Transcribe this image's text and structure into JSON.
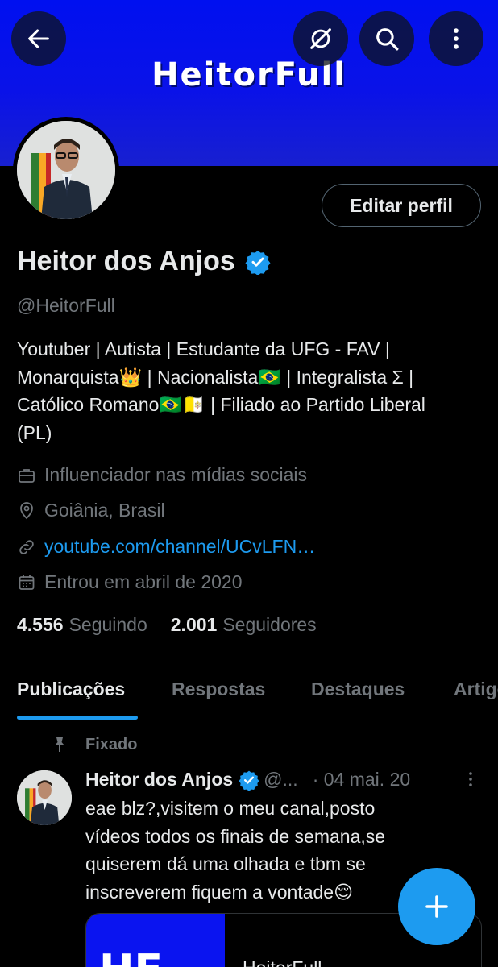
{
  "banner": {
    "text": "HeitorFull",
    "color": "#0010f0"
  },
  "header_actions": {
    "back_icon": "arrow-left-icon",
    "grok_icon": "grok-icon",
    "search_icon": "search-icon",
    "more_icon": "more-vertical-icon"
  },
  "profile": {
    "edit_button": "Editar perfil",
    "name": "Heitor dos Anjos",
    "handle": "@HeitorFull",
    "bio_lines": [
      "Youtuber | Autista | Estudante da UFG - FAV |",
      "Monarquista👑 | Nacionalista🇧🇷 | Integralista Σ |",
      "Católico Romano🇧🇷🇻🇦 | Filiado ao Partido Liberal",
      "(PL)"
    ],
    "category": "Influenciador nas mídias sociais",
    "location": "Goiânia, Brasil",
    "link": "youtube.com/channel/UCvLFN…",
    "joined": "Entrou em abril de 2020",
    "following_count": "4.556",
    "following_label": "Seguindo",
    "followers_count": "2.001",
    "followers_label": "Seguidores"
  },
  "tabs": [
    "Publicações",
    "Respostas",
    "Destaques",
    "Artigos"
  ],
  "active_tab": "Publicações",
  "pinned_post": {
    "pinned_label": "Fixado",
    "author": "Heitor dos Anjos",
    "handle": "@...",
    "date": "· 04 mai. 20",
    "text_lines": [
      "eae blz?,visitem o meu canal,posto",
      "vídeos todos os finais de semana,se",
      "quiserem dá uma olhada e tbm se",
      "inscreverem fiquem a vontade😌"
    ],
    "card_thumb_text": "HF",
    "card_title": "HeitorFull"
  },
  "fab": {
    "icon": "plus-icon"
  },
  "colors": {
    "accent": "#1d9bf0",
    "background": "#000000",
    "muted": "#71767b"
  }
}
